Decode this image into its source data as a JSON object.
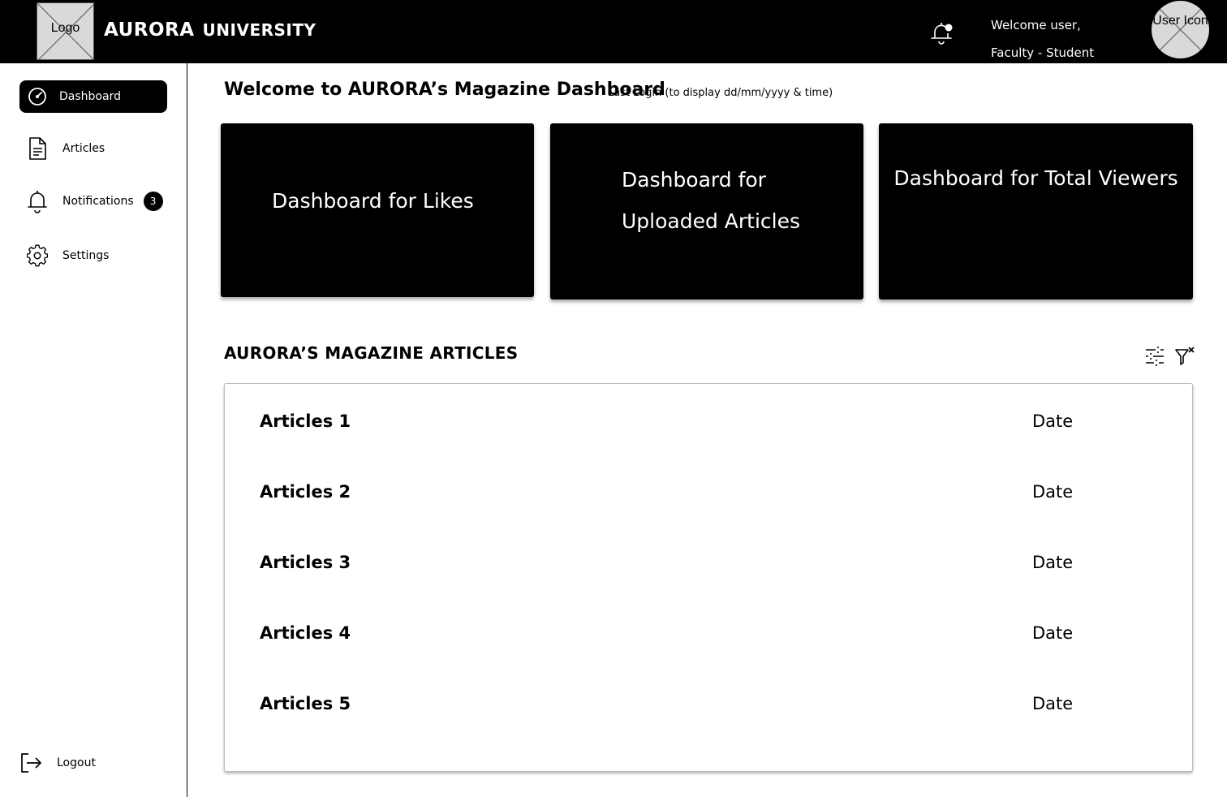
{
  "header": {
    "logo_text": "Logo",
    "brand_primary": "AURORA",
    "brand_secondary": "UNIVERSITY",
    "welcome_line1": "Welcome user,",
    "welcome_line2": "Faculty - Student",
    "avatar_text": "User Icon"
  },
  "sidebar": {
    "items": [
      {
        "label": "Dashboard",
        "icon": "dashboard-gauge-icon",
        "active": true
      },
      {
        "label": "Articles",
        "icon": "document-icon"
      },
      {
        "label": "Notifications",
        "icon": "bell-icon",
        "badge": "3"
      },
      {
        "label": "Settings",
        "icon": "gear-icon"
      }
    ],
    "logout_label": "Logout"
  },
  "main": {
    "title": "Welcome to AURORA’s Magazine Dashboard",
    "last_login": "Last Login  (to display dd/mm/yyyy  & time)",
    "cards": [
      {
        "label": "Dashboard for Likes"
      },
      {
        "label": "Dashboard for Uploaded Articles"
      },
      {
        "label": "Dashboard for Total Viewers"
      }
    ],
    "section_title": "AURORA’S MAGAZINE ARTICLES",
    "articles": [
      {
        "title": "Articles 1",
        "date": "Date"
      },
      {
        "title": "Articles 2",
        "date": "Date"
      },
      {
        "title": "Articles 3",
        "date": "Date"
      },
      {
        "title": "Articles 4",
        "date": "Date"
      },
      {
        "title": "Articles 5",
        "date": "Date"
      }
    ]
  },
  "colors": {
    "topbar": "#000000",
    "accent": "#000000",
    "placeholder": "#d9d9d9"
  }
}
